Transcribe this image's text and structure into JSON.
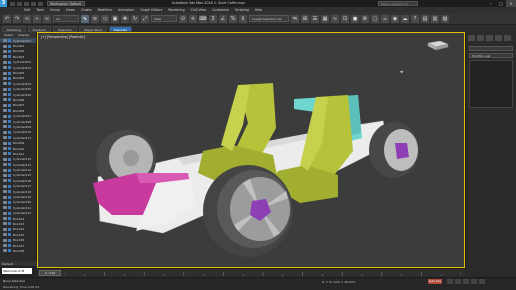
{
  "app": {
    "title": "Autodesk 3ds Max 2016   1. Start Coffe.max",
    "workspace": "Workspace: Default",
    "search_placeholder": "Type a keyword or phrase"
  },
  "menu": [
    "Edit",
    "Tools",
    "Group",
    "Views",
    "Create",
    "Modifiers",
    "Animation",
    "Graph Editors",
    "Rendering",
    "Civil View",
    "Customize",
    "Scripting",
    "Help"
  ],
  "toolbar": {
    "selection_set": "All",
    "view_dropdown": "View",
    "named_selection": "Create Selection Se"
  },
  "ribbon_tabs": [
    "Modeling",
    "Freeform",
    "Selection",
    "Object Paint",
    "Populate"
  ],
  "explorer": {
    "tabs": [
      "Select",
      "Display"
    ],
    "objects": [
      "Cylinder001",
      "Box001",
      "Box002",
      "Box003",
      "Cylinder002",
      "Cylinder003",
      "Box004",
      "Box005",
      "Cylinder004",
      "Cylinder005",
      "Cylinder006",
      "Box006",
      "Box007",
      "Box008",
      "Cylinder007",
      "Cylinder008",
      "Cylinder009",
      "Cylinder010",
      "Cylinder011",
      "Box009",
      "Box010",
      "Box011",
      "Cylinder012",
      "Cylinder013",
      "Cylinder014",
      "Cylinder015",
      "Cylinder016",
      "Cylinder017",
      "Cylinder018",
      "Cylinder019",
      "Cylinder020",
      "Cylinder021",
      "Cylinder022",
      "Box012",
      "Box013",
      "Box014",
      "Box015",
      "Box016",
      "Box017",
      "Box018"
    ],
    "bottom_label": "Default"
  },
  "viewport": {
    "label": "[+] [Perspective] [Realistic]"
  },
  "cmdpanel": {
    "modifier_list": "Modifier List"
  },
  "timeline": {
    "frame": "0 / 100"
  },
  "status": {
    "selection": "None Selected",
    "prompt": "Rendering Time 0:00:02",
    "coords": "X:      Y:      Z:      Grid = 10,0cm",
    "autokey": "Auto Key",
    "maxscript": "Welcome to M"
  },
  "colors": {
    "seat": "#b5c23a",
    "rim_center": "#8f3fb5",
    "fender": "#c93a9e",
    "cyan_panel": "#6fd6cf",
    "chassis": "#efefef",
    "tire": "#4a4a4a",
    "viewport_border": "#e0c200"
  }
}
